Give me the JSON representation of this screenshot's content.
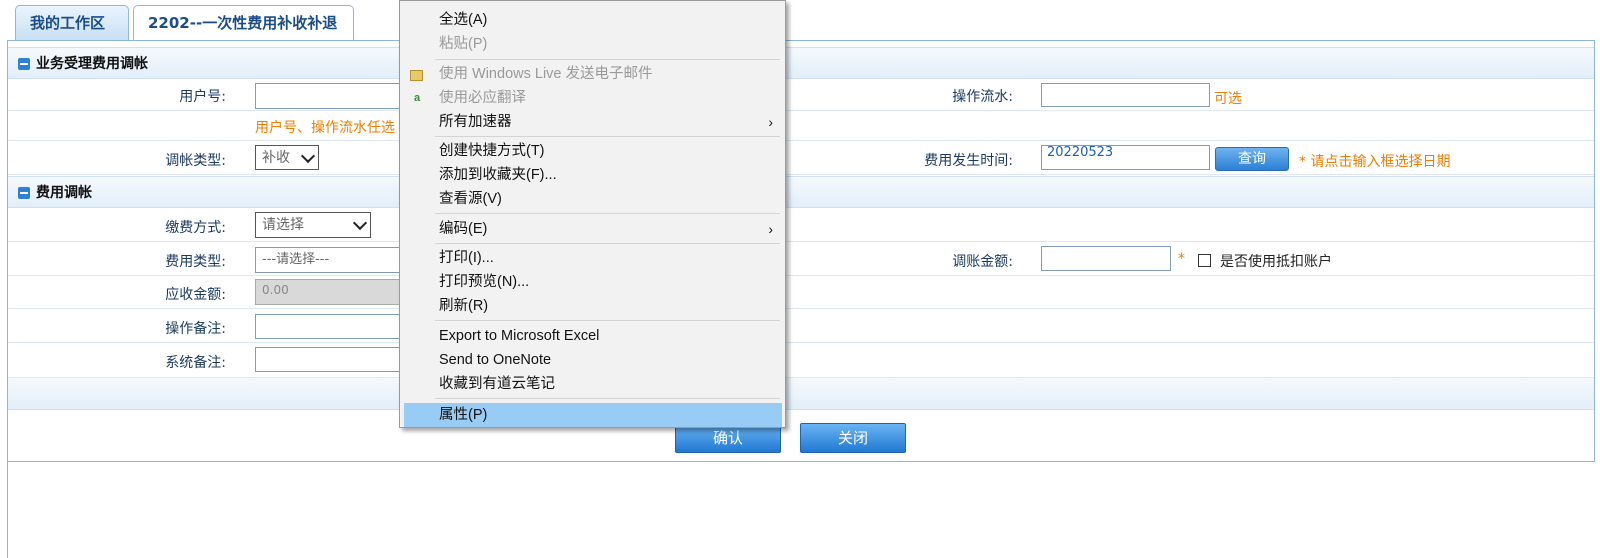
{
  "tabs": [
    {
      "label": "我的工作区"
    },
    {
      "label": "2202--一次性费用补收补退",
      "close": "×"
    }
  ],
  "section1": {
    "title": "业务受理费用调帐",
    "user_no_label": "用户号:",
    "serial_label": "操作流水:",
    "serial_hint": "可选",
    "hint_text": "用户号、操作流水任选",
    "adjust_type_label": "调帐类型:",
    "adjust_type_value": "补收",
    "fee_time_label": "费用发生时间:",
    "fee_time_value": "20220523",
    "query_label": "查询",
    "date_hint": "* 请点击输入框选择日期"
  },
  "section2": {
    "title": "费用调帐",
    "pay_method_label": "缴费方式:",
    "pay_method_value": "请选择",
    "fee_type_label": "费用类型:",
    "fee_type_value": "---请选择---",
    "adjust_amount_label": "调账金额:",
    "required_mark": "*",
    "deduct_label": "是否使用抵扣账户",
    "receivable_label": "应收金额:",
    "receivable_value": "0.00",
    "op_note_label": "操作备注:",
    "sys_note_label": "系统备注:"
  },
  "actions": {
    "confirm": "确认",
    "close": "关闭"
  },
  "context_menu": {
    "items": [
      {
        "label": "全选(A)"
      },
      {
        "label": "粘贴(P)"
      },
      {
        "label": "使用 Windows Live 发送电子邮件"
      },
      {
        "label": "使用必应翻译"
      },
      {
        "label": "所有加速器"
      },
      {
        "label": "创建快捷方式(T)"
      },
      {
        "label": "添加到收藏夹(F)..."
      },
      {
        "label": "查看源(V)"
      },
      {
        "label": "编码(E)"
      },
      {
        "label": "打印(I)..."
      },
      {
        "label": "打印预览(N)..."
      },
      {
        "label": "刷新(R)"
      },
      {
        "label": "Export to Microsoft Excel"
      },
      {
        "label": "Send to OneNote"
      },
      {
        "label": "收藏到有道云笔记"
      },
      {
        "label": "属性(P)"
      }
    ],
    "submenu_arrow": "›"
  },
  "colors": {
    "accent_blue": "#2a7fd4",
    "hint_orange": "#f07c00",
    "menu_highlight": "#99ccf5"
  }
}
